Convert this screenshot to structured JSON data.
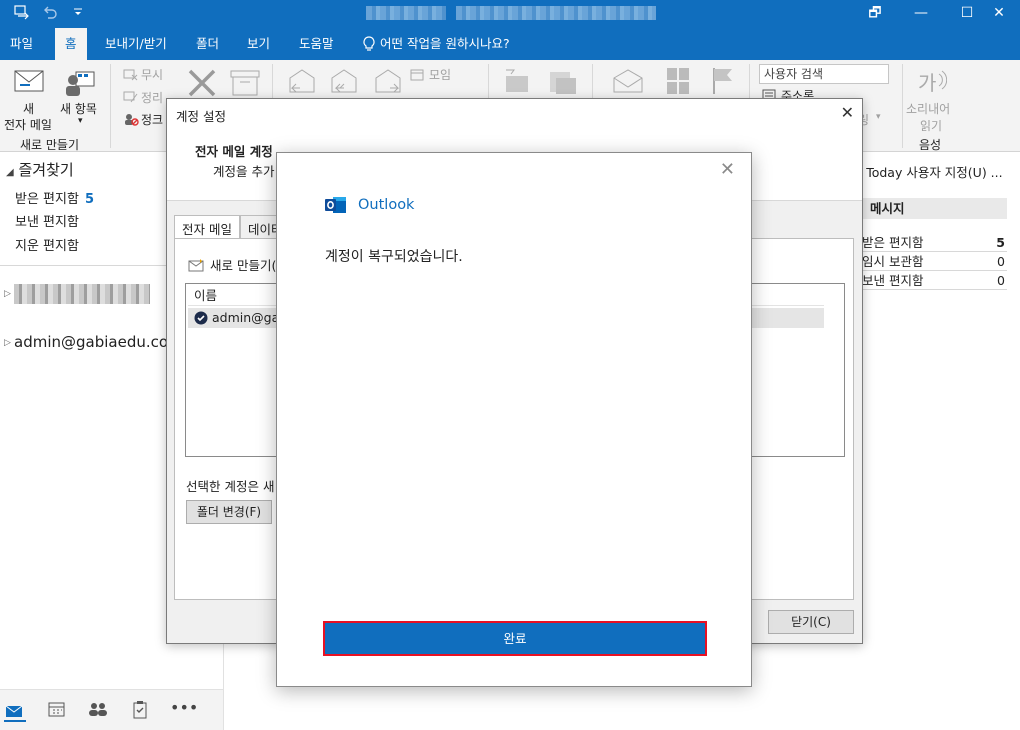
{
  "window": {
    "quick_access": [
      "send-receive-icon",
      "undo-icon",
      "customize-icon"
    ],
    "controls": {
      "restore": "🗗",
      "minimize": "—",
      "maximize": "☐",
      "close": "✕"
    }
  },
  "ribbon_tabs": [
    "파일",
    "홈",
    "보내기/받기",
    "폴더",
    "보기",
    "도움말"
  ],
  "active_tab": "홈",
  "tell_me": "어떤 작업을 원하시나요?",
  "ribbon": {
    "new_email_line1": "새",
    "new_email_line2": "전자 메일",
    "new_items": "새 항목",
    "new_group_label": "새로 만들기",
    "ignore": "무시",
    "cleanup": "정리",
    "junk": "정크",
    "meeting": "모임",
    "search_people_placeholder": "사용자 검색",
    "address_book": "주소록",
    "read_aloud_line1": "소리내어",
    "read_aloud_line2": "읽기",
    "speech_group": "음성",
    "filter_fragment": "링"
  },
  "nav": {
    "favorites": "즐겨찾기",
    "inbox": "받은 편지함",
    "inbox_count": "5",
    "sent": "보낸 편지함",
    "deleted": "지운 편지함",
    "account": "admin@gabiaedu.com"
  },
  "today": {
    "customize": "k Today 사용자 지정(U) ...",
    "messages_header": "메시지",
    "rows": [
      {
        "label": "받은 편지함",
        "value": "5"
      },
      {
        "label": "임시 보관함",
        "value": "0"
      },
      {
        "label": "보낸 편지함",
        "value": "0"
      }
    ]
  },
  "account_settings": {
    "title": "계정 설정",
    "heading": "전자 메일 계정",
    "subheading": "계정을 추가",
    "tab_email": "전자 메일",
    "tab_data": "데이터",
    "new_button": "새로 만들기(",
    "col_name": "이름",
    "account_row": "admin@gab",
    "selected_note": "선택한 계정은 새",
    "change_folder": "폴더 변경(F)",
    "close": "닫기(C)"
  },
  "outlook_dialog": {
    "brand": "Outlook",
    "message": "계정이 복구되었습니다.",
    "done_button": "완료",
    "close_glyph": "✕"
  },
  "colors": {
    "accent": "#106ebe",
    "highlight_border": "#e81123"
  }
}
